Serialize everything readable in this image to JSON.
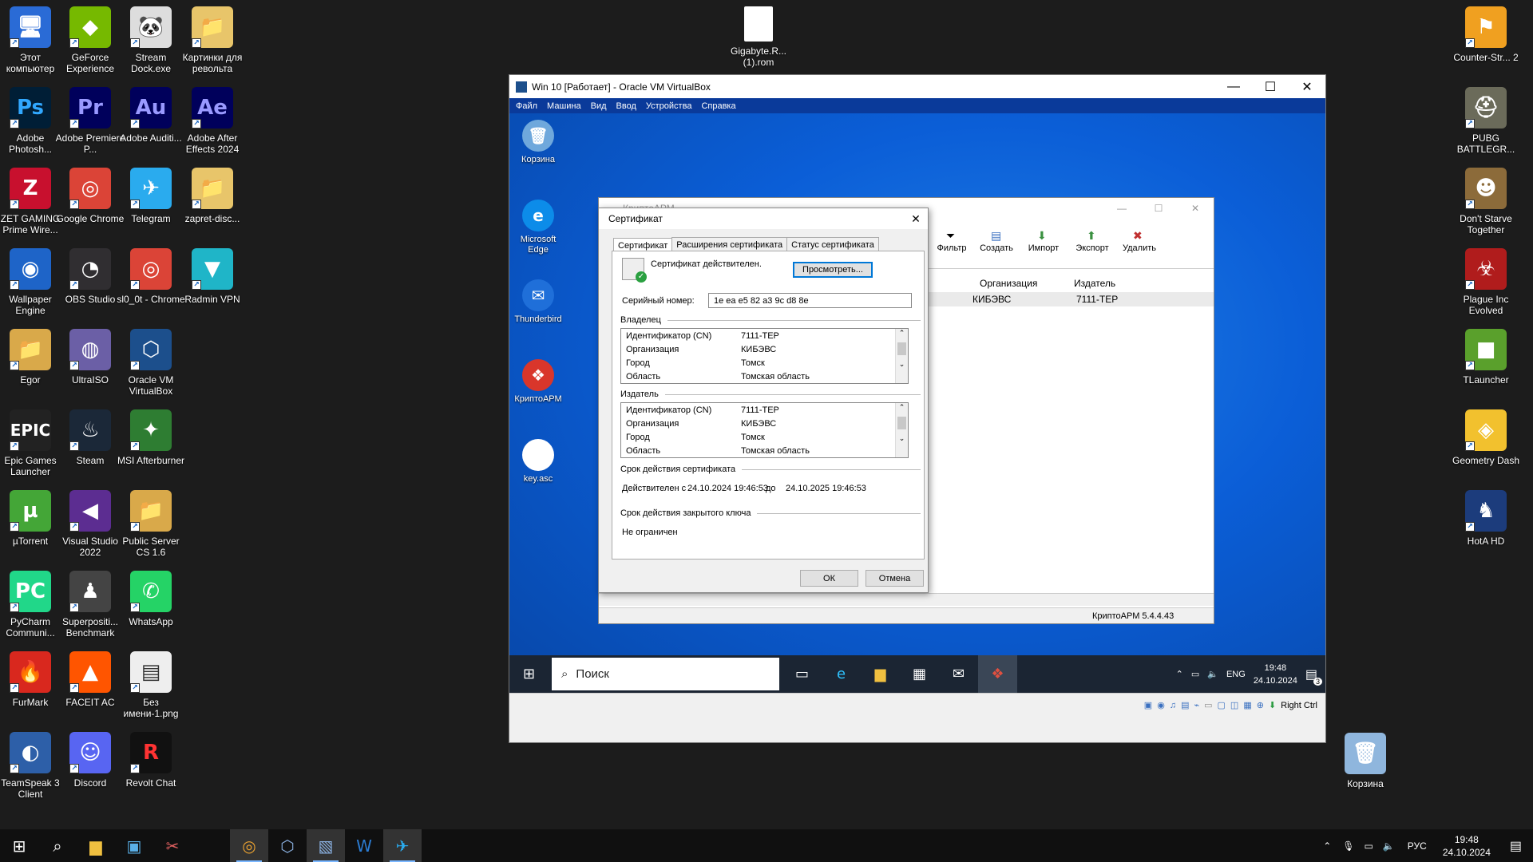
{
  "desktop": {
    "icons_col1": [
      {
        "label": "Этот компьютер",
        "glyph": "🖥",
        "bg": "#2a6bd6"
      },
      {
        "label": "Adobe Photosh...",
        "glyph": "Ps",
        "bg": "#001e36",
        "fg": "#31a8ff"
      },
      {
        "label": "ZET GAMING Prime Wire...",
        "glyph": "Z",
        "bg": "#c8102e"
      },
      {
        "label": "Wallpaper Engine",
        "glyph": "◉",
        "bg": "#1e64c8"
      },
      {
        "label": "Egor",
        "glyph": "📁",
        "bg": "#d9a94a"
      },
      {
        "label": "Epic Games Launcher",
        "glyph": "EPIC",
        "bg": "#222"
      },
      {
        "label": "µTorrent",
        "glyph": "µ",
        "bg": "#44a637"
      },
      {
        "label": "PyCharm Communi...",
        "glyph": "PC",
        "bg": "#21d789"
      },
      {
        "label": "FurMark",
        "glyph": "🔥",
        "bg": "#d9281e"
      },
      {
        "label": "TeamSpeak 3 Client",
        "glyph": "◐",
        "bg": "#2d5fa8"
      }
    ],
    "icons_col2": [
      {
        "label": "GeForce Experience",
        "glyph": "◆",
        "bg": "#76b900"
      },
      {
        "label": "Adobe Premiere P...",
        "glyph": "Pr",
        "bg": "#00005b",
        "fg": "#9999ff"
      },
      {
        "label": "Google Chrome",
        "glyph": "◎",
        "bg": "#db4437"
      },
      {
        "label": "OBS Studio",
        "glyph": "◔",
        "bg": "#302e31"
      },
      {
        "label": "UltraISO",
        "glyph": "◍",
        "bg": "#6b5fa6"
      },
      {
        "label": "Steam",
        "glyph": "♨",
        "bg": "#1b2838"
      },
      {
        "label": "Visual Studio 2022",
        "glyph": "◀",
        "bg": "#5c2d91"
      },
      {
        "label": "Superpositi... Benchmark",
        "glyph": "♟",
        "bg": "#444"
      },
      {
        "label": "FACEIT AC",
        "glyph": "▲",
        "bg": "#ff5500"
      },
      {
        "label": "Discord",
        "glyph": "☺",
        "bg": "#5865f2"
      }
    ],
    "icons_col3": [
      {
        "label": "Stream Dock.exe",
        "glyph": "🐼",
        "bg": "#ddd"
      },
      {
        "label": "Adobe Auditi...",
        "glyph": "Au",
        "bg": "#00005b",
        "fg": "#9999ff"
      },
      {
        "label": "Telegram",
        "glyph": "✈",
        "bg": "#2aabee"
      },
      {
        "label": "sl0_0t - Chrome",
        "glyph": "◎",
        "bg": "#db4437"
      },
      {
        "label": "Oracle VM VirtualBox",
        "glyph": "⬡",
        "bg": "#1c4f8c"
      },
      {
        "label": "MSI Afterburner",
        "glyph": "✦",
        "bg": "#2e7d32"
      },
      {
        "label": "Public Server CS 1.6",
        "glyph": "📁",
        "bg": "#d9a94a"
      },
      {
        "label": "WhatsApp",
        "glyph": "✆",
        "bg": "#25d366"
      },
      {
        "label": "Без имени-1.png",
        "glyph": "▤",
        "bg": "#eee",
        "fg": "#333"
      },
      {
        "label": "Revolt Chat",
        "glyph": "R",
        "bg": "#111",
        "fg": "#ff3333"
      }
    ],
    "icons_col4": [
      {
        "label": "Картинки для револьта",
        "glyph": "📁",
        "bg": "#e8c56a"
      },
      {
        "label": "Adobe After Effects 2024",
        "glyph": "Ae",
        "bg": "#00005b",
        "fg": "#9999ff"
      },
      {
        "label": "zapret-disc...",
        "glyph": "📁",
        "bg": "#e8c56a"
      },
      {
        "label": "Radmin VPN",
        "glyph": "▼",
        "bg": "#1fb5c8"
      }
    ],
    "icons_right": [
      {
        "label": "Counter-Str... 2",
        "glyph": "⚑",
        "bg": "#f0a020"
      },
      {
        "label": "PUBG BATTLEGR...",
        "glyph": "⛑",
        "bg": "#6b6b5a"
      },
      {
        "label": "Don't Starve Together",
        "glyph": "☻",
        "bg": "#8c6b3a"
      },
      {
        "label": "Plague Inc Evolved",
        "glyph": "☣",
        "bg": "#b01c1c"
      },
      {
        "label": "TLauncher",
        "glyph": "■",
        "bg": "#5aa02c"
      },
      {
        "label": "Geometry Dash",
        "glyph": "◈",
        "bg": "#f2c12e"
      },
      {
        "label": "HotA HD",
        "glyph": "♞",
        "bg": "#1c3c7c"
      }
    ],
    "file_top": {
      "label": "Gigabyte.R... (1).rom"
    },
    "recycle": {
      "label": "Корзина"
    }
  },
  "host_taskbar": {
    "lang": "РУС",
    "time": "19:48",
    "date": "24.10.2024"
  },
  "vbox": {
    "title": "Win 10 [Работает] - Oracle VM VirtualBox",
    "menu": [
      "Файл",
      "Машина",
      "Вид",
      "Ввод",
      "Устройства",
      "Справка"
    ],
    "host_key": "Right Ctrl"
  },
  "guest": {
    "icons": [
      {
        "label": "Корзина",
        "glyph": "🗑",
        "bg": "#6fa8dc"
      },
      {
        "label": "Microsoft Edge",
        "glyph": "e",
        "bg": "#0c8ce9"
      },
      {
        "label": "Thunderbird",
        "glyph": "✉",
        "bg": "#1f6fd9"
      },
      {
        "label": "КриптоАРМ",
        "glyph": "❖",
        "bg": "#d9362b"
      },
      {
        "label": "key.asc",
        "glyph": "▯",
        "bg": "#ffffff"
      }
    ],
    "search_placeholder": "Поиск",
    "lang": "ENG",
    "time": "19:48",
    "date": "24.10.2024",
    "notif_count": "3"
  },
  "crypto": {
    "title": "КриптоАРМ",
    "toolbar": [
      "Фильтр",
      "Создать",
      "Импорт",
      "Экспорт",
      "Удалить"
    ],
    "columns": [
      "Организация",
      "Издатель"
    ],
    "row": [
      "КИБЭВС",
      "7111-ТЕР"
    ],
    "status": "КриптоАРМ 5.4.4.43"
  },
  "dialog": {
    "title": "Сертификат",
    "tabs": [
      "Сертификат",
      "Расширения сертификата",
      "Статус сертификата"
    ],
    "valid_text": "Сертификат действителен.",
    "view_button": "Просмотреть...",
    "serial_label": "Серийный номер:",
    "serial_value": "1e ea e5 82 a3 9c d8 8e",
    "owner_label": "Владелец",
    "issuer_label": "Издатель",
    "owner_rows": [
      {
        "k": "Идентификатор (CN)",
        "v": "7111-ТЕР"
      },
      {
        "k": "Организация",
        "v": "КИБЭВС"
      },
      {
        "k": "Город",
        "v": "Томск"
      },
      {
        "k": "Область",
        "v": "Томская область"
      }
    ],
    "issuer_rows": [
      {
        "k": "Идентификатор (CN)",
        "v": "7111-ТЕР"
      },
      {
        "k": "Организация",
        "v": "КИБЭВС"
      },
      {
        "k": "Город",
        "v": "Томск"
      },
      {
        "k": "Область",
        "v": "Томская область"
      }
    ],
    "validity_label": "Срок действия сертификата",
    "valid_from_label": "Действителен с",
    "valid_from": "24.10.2024 19:46:53",
    "to_label": "до",
    "valid_to": "24.10.2025 19:46:53",
    "key_validity_label": "Срок действия закрытого ключа",
    "key_validity_value": "Не ограничен",
    "ok": "ОК",
    "cancel": "Отмена"
  }
}
